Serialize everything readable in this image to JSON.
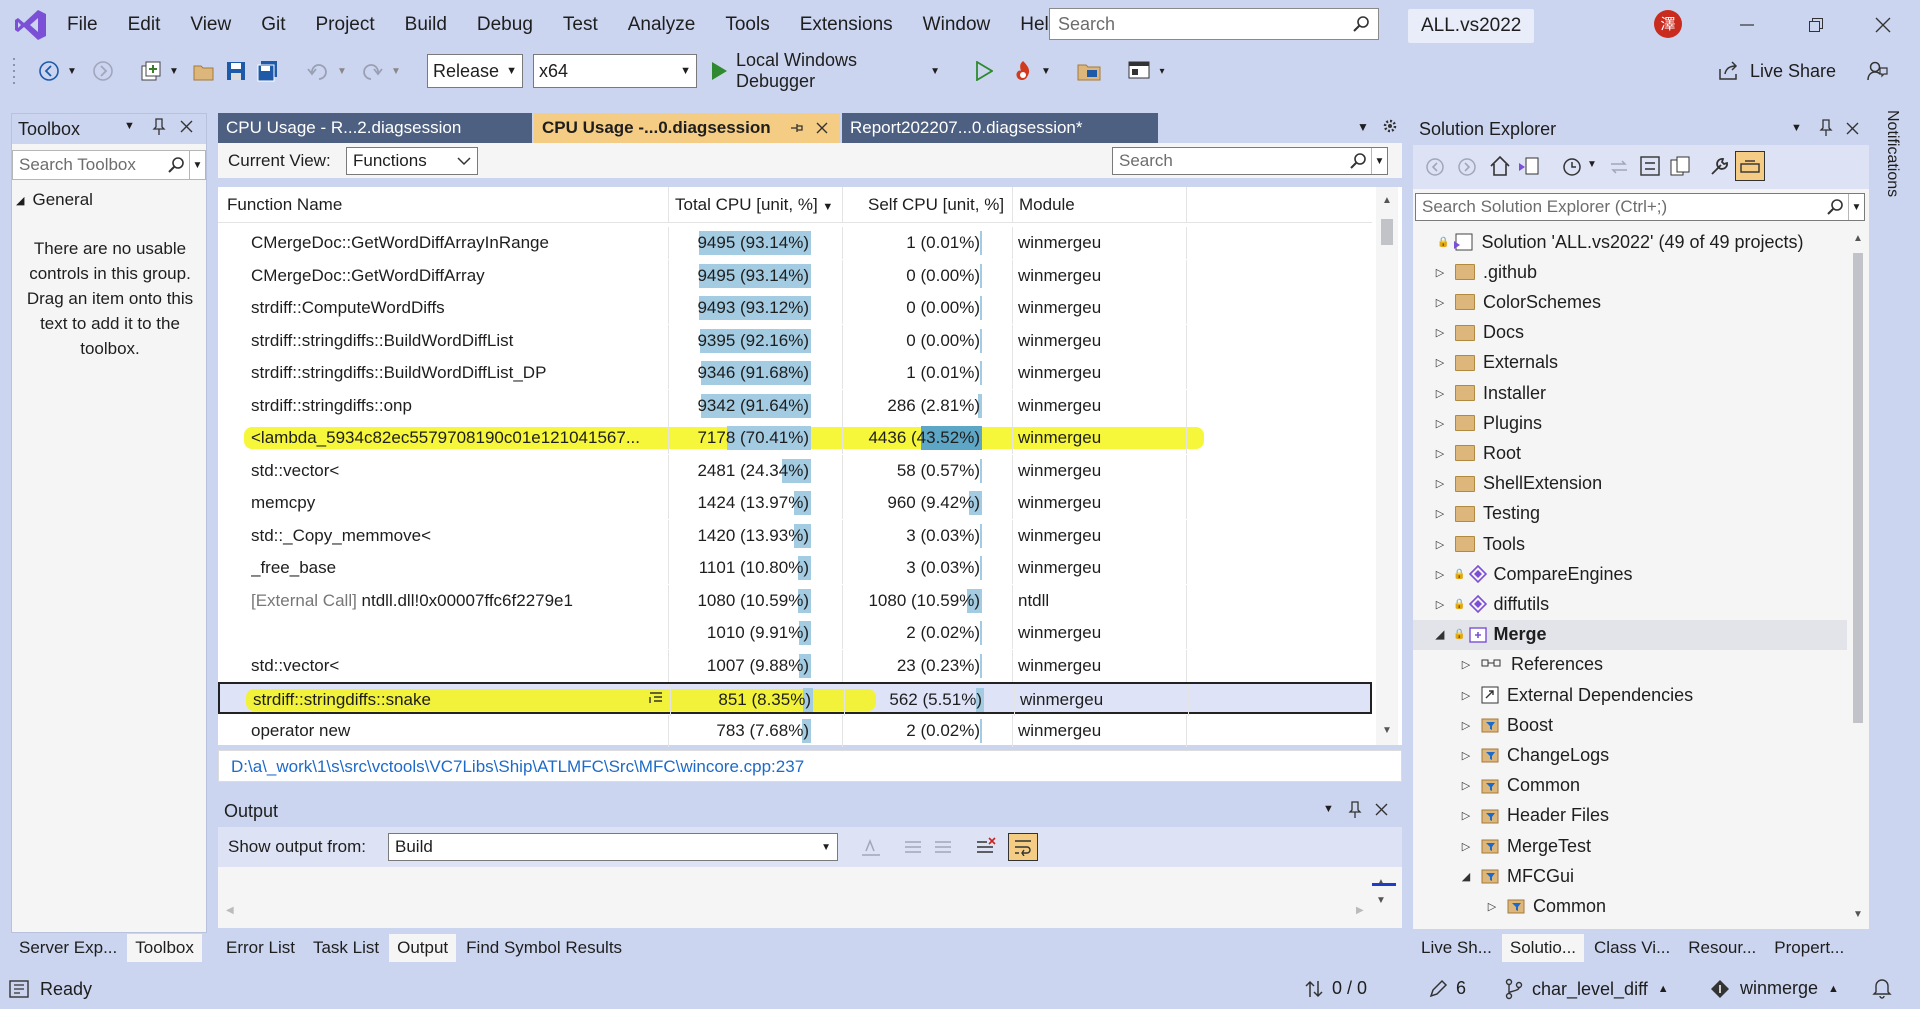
{
  "menu": [
    "File",
    "Edit",
    "View",
    "Git",
    "Project",
    "Build",
    "Debug",
    "Test",
    "Analyze",
    "Tools",
    "Extensions",
    "Window",
    "Help"
  ],
  "search_top": {
    "placeholder": "Search"
  },
  "solution_badge": "ALL.vs2022",
  "avatar_text": "澤",
  "toolbar": {
    "config": "Release",
    "platform": "x64",
    "debugger": "Local Windows Debugger",
    "live_share": "Live Share"
  },
  "toolbox": {
    "title": "Toolbox",
    "search_placeholder": "Search Toolbox",
    "group": "General",
    "empty_text": "There are no usable controls in this group. Drag an item onto this text to add it to the toolbox.",
    "bottom_tabs": [
      "Server Exp...",
      "Toolbox"
    ]
  },
  "doc_tabs": [
    "CPU Usage - R...2.diagsession",
    "CPU Usage -...0.diagsession",
    "Report202207...0.diagsession*"
  ],
  "cpu": {
    "current_view_label": "Current View:",
    "current_view": "Functions",
    "search_placeholder": "Search",
    "columns": [
      "Function Name",
      "Total CPU [unit, %]",
      "Self CPU [unit, %]",
      "Module"
    ],
    "rows": [
      {
        "name": "CMergeDoc::GetWordDiffArrayInRange",
        "total": "9495 (93.14%)",
        "total_pct": 93.14,
        "self": "1 (0.01%)",
        "self_pct": 0.01,
        "module": "winmergeu"
      },
      {
        "name": "CMergeDoc::GetWordDiffArray",
        "total": "9495 (93.14%)",
        "total_pct": 93.14,
        "self": "0 (0.00%)",
        "self_pct": 0,
        "module": "winmergeu"
      },
      {
        "name": "strdiff::ComputeWordDiffs",
        "total": "9493 (93.12%)",
        "total_pct": 93.12,
        "self": "0 (0.00%)",
        "self_pct": 0,
        "module": "winmergeu"
      },
      {
        "name": "strdiff::stringdiffs::BuildWordDiffList",
        "total": "9395 (92.16%)",
        "total_pct": 92.16,
        "self": "0 (0.00%)",
        "self_pct": 0,
        "module": "winmergeu"
      },
      {
        "name": "strdiff::stringdiffs::BuildWordDiffList_DP",
        "total": "9346 (91.68%)",
        "total_pct": 91.68,
        "self": "1 (0.01%)",
        "self_pct": 0.01,
        "module": "winmergeu"
      },
      {
        "name": "strdiff::stringdiffs::onp",
        "total": "9342 (91.64%)",
        "total_pct": 91.64,
        "self": "286 (2.81%)",
        "self_pct": 2.81,
        "module": "winmergeu"
      },
      {
        "name": "<lambda_5934c82ec5579708190c01e121041567...",
        "total": "7178 (70.41%)",
        "total_pct": 70.41,
        "self": "4436 (43.52%)",
        "self_pct": 43.52,
        "module": "winmergeu",
        "highlight": true
      },
      {
        "name": "std::vector<",
        "total": "2481 (24.34%)",
        "total_pct": 24.34,
        "self": "58 (0.57%)",
        "self_pct": 0.57,
        "module": "winmergeu"
      },
      {
        "name": "memcpy",
        "total": "1424 (13.97%)",
        "total_pct": 13.97,
        "self": "960 (9.42%)",
        "self_pct": 9.42,
        "module": "winmergeu"
      },
      {
        "name": "std::_Copy_memmove<",
        "total": "1420 (13.93%)",
        "total_pct": 13.93,
        "self": "3 (0.03%)",
        "self_pct": 0.03,
        "module": "winmergeu"
      },
      {
        "name": "_free_base",
        "total": "1101 (10.80%)",
        "total_pct": 10.8,
        "self": "3 (0.03%)",
        "self_pct": 0.03,
        "module": "winmergeu"
      },
      {
        "name_prefix": "[External Call]",
        "name": " ntdll.dll!0x00007ffc6f2279e1",
        "total": "1080 (10.59%)",
        "total_pct": 10.59,
        "self": "1080 (10.59%)",
        "self_pct": 10.59,
        "module": "ntdll"
      },
      {
        "name": "",
        "total": "1010 (9.91%)",
        "total_pct": 9.91,
        "self": "2 (0.02%)",
        "self_pct": 0.02,
        "module": "winmergeu"
      },
      {
        "name": "std::vector<",
        "total": "1007 (9.88%)",
        "total_pct": 9.88,
        "self": "23 (0.23%)",
        "self_pct": 0.23,
        "module": "winmergeu"
      },
      {
        "name": "strdiff::stringdiffs::snake",
        "total": "851 (8.35%)",
        "total_pct": 8.35,
        "self": "562 (5.51%)",
        "self_pct": 5.51,
        "module": "winmergeu",
        "highlight": true,
        "selected": true
      },
      {
        "name": "operator new",
        "total": "783 (7.68%)",
        "total_pct": 7.68,
        "self": "2 (0.02%)",
        "self_pct": 0.02,
        "module": "winmergeu"
      }
    ],
    "path": "D:\\a\\_work\\1\\s\\src\\vctools\\VC7Libs\\Ship\\ATLMFC\\Src\\MFC\\wincore.cpp:237"
  },
  "output": {
    "title": "Output",
    "show_from_label": "Show output from:",
    "show_from": "Build",
    "bottom_tabs": [
      "Error List",
      "Task List",
      "Output",
      "Find Symbol Results"
    ]
  },
  "solution_explorer": {
    "title": "Solution Explorer",
    "search_placeholder": "Search Solution Explorer (Ctrl+;)",
    "items": [
      {
        "label": "Solution 'ALL.vs2022' (49 of 49 projects)",
        "kind": "solution",
        "level": 0
      },
      {
        "label": ".github",
        "kind": "folder",
        "level": 1
      },
      {
        "label": "ColorSchemes",
        "kind": "folder",
        "level": 1
      },
      {
        "label": "Docs",
        "kind": "folder",
        "level": 1
      },
      {
        "label": "Externals",
        "kind": "folder",
        "level": 1
      },
      {
        "label": "Installer",
        "kind": "folder",
        "level": 1
      },
      {
        "label": "Plugins",
        "kind": "folder",
        "level": 1
      },
      {
        "label": "Root",
        "kind": "folder",
        "level": 1
      },
      {
        "label": "ShellExtension",
        "kind": "folder",
        "level": 1
      },
      {
        "label": "Testing",
        "kind": "folder",
        "level": 1
      },
      {
        "label": "Tools",
        "kind": "folder",
        "level": 1
      },
      {
        "label": "CompareEngines",
        "kind": "project",
        "level": 1
      },
      {
        "label": "diffutils",
        "kind": "project",
        "level": 1
      },
      {
        "label": "Merge",
        "kind": "project-open",
        "level": 1,
        "bold": true
      },
      {
        "label": "References",
        "kind": "refs",
        "level": 2
      },
      {
        "label": "External Dependencies",
        "kind": "extdeps",
        "level": 2
      },
      {
        "label": "Boost",
        "kind": "filter",
        "level": 2
      },
      {
        "label": "ChangeLogs",
        "kind": "filter",
        "level": 2
      },
      {
        "label": "Common",
        "kind": "filter",
        "level": 2
      },
      {
        "label": "Header Files",
        "kind": "filter",
        "level": 2
      },
      {
        "label": "MergeTest",
        "kind": "filter",
        "level": 2
      },
      {
        "label": "MFCGui",
        "kind": "filter-open",
        "level": 2
      },
      {
        "label": "Common",
        "kind": "filter",
        "level": 3
      }
    ],
    "bottom_tabs": [
      "Live Sh...",
      "Solutio...",
      "Class Vi...",
      "Resour...",
      "Propert..."
    ]
  },
  "notifications_label": "Notifications",
  "status": {
    "ready": "Ready",
    "sync": "0 / 0",
    "edits": "6",
    "branch": "char_level_diff",
    "repo": "winmerge"
  },
  "colors": {
    "accent": "#ccd5f0",
    "highlight": "#f5f518",
    "selected_tab": "#f5cc84",
    "bar": "#a3cbe2"
  }
}
